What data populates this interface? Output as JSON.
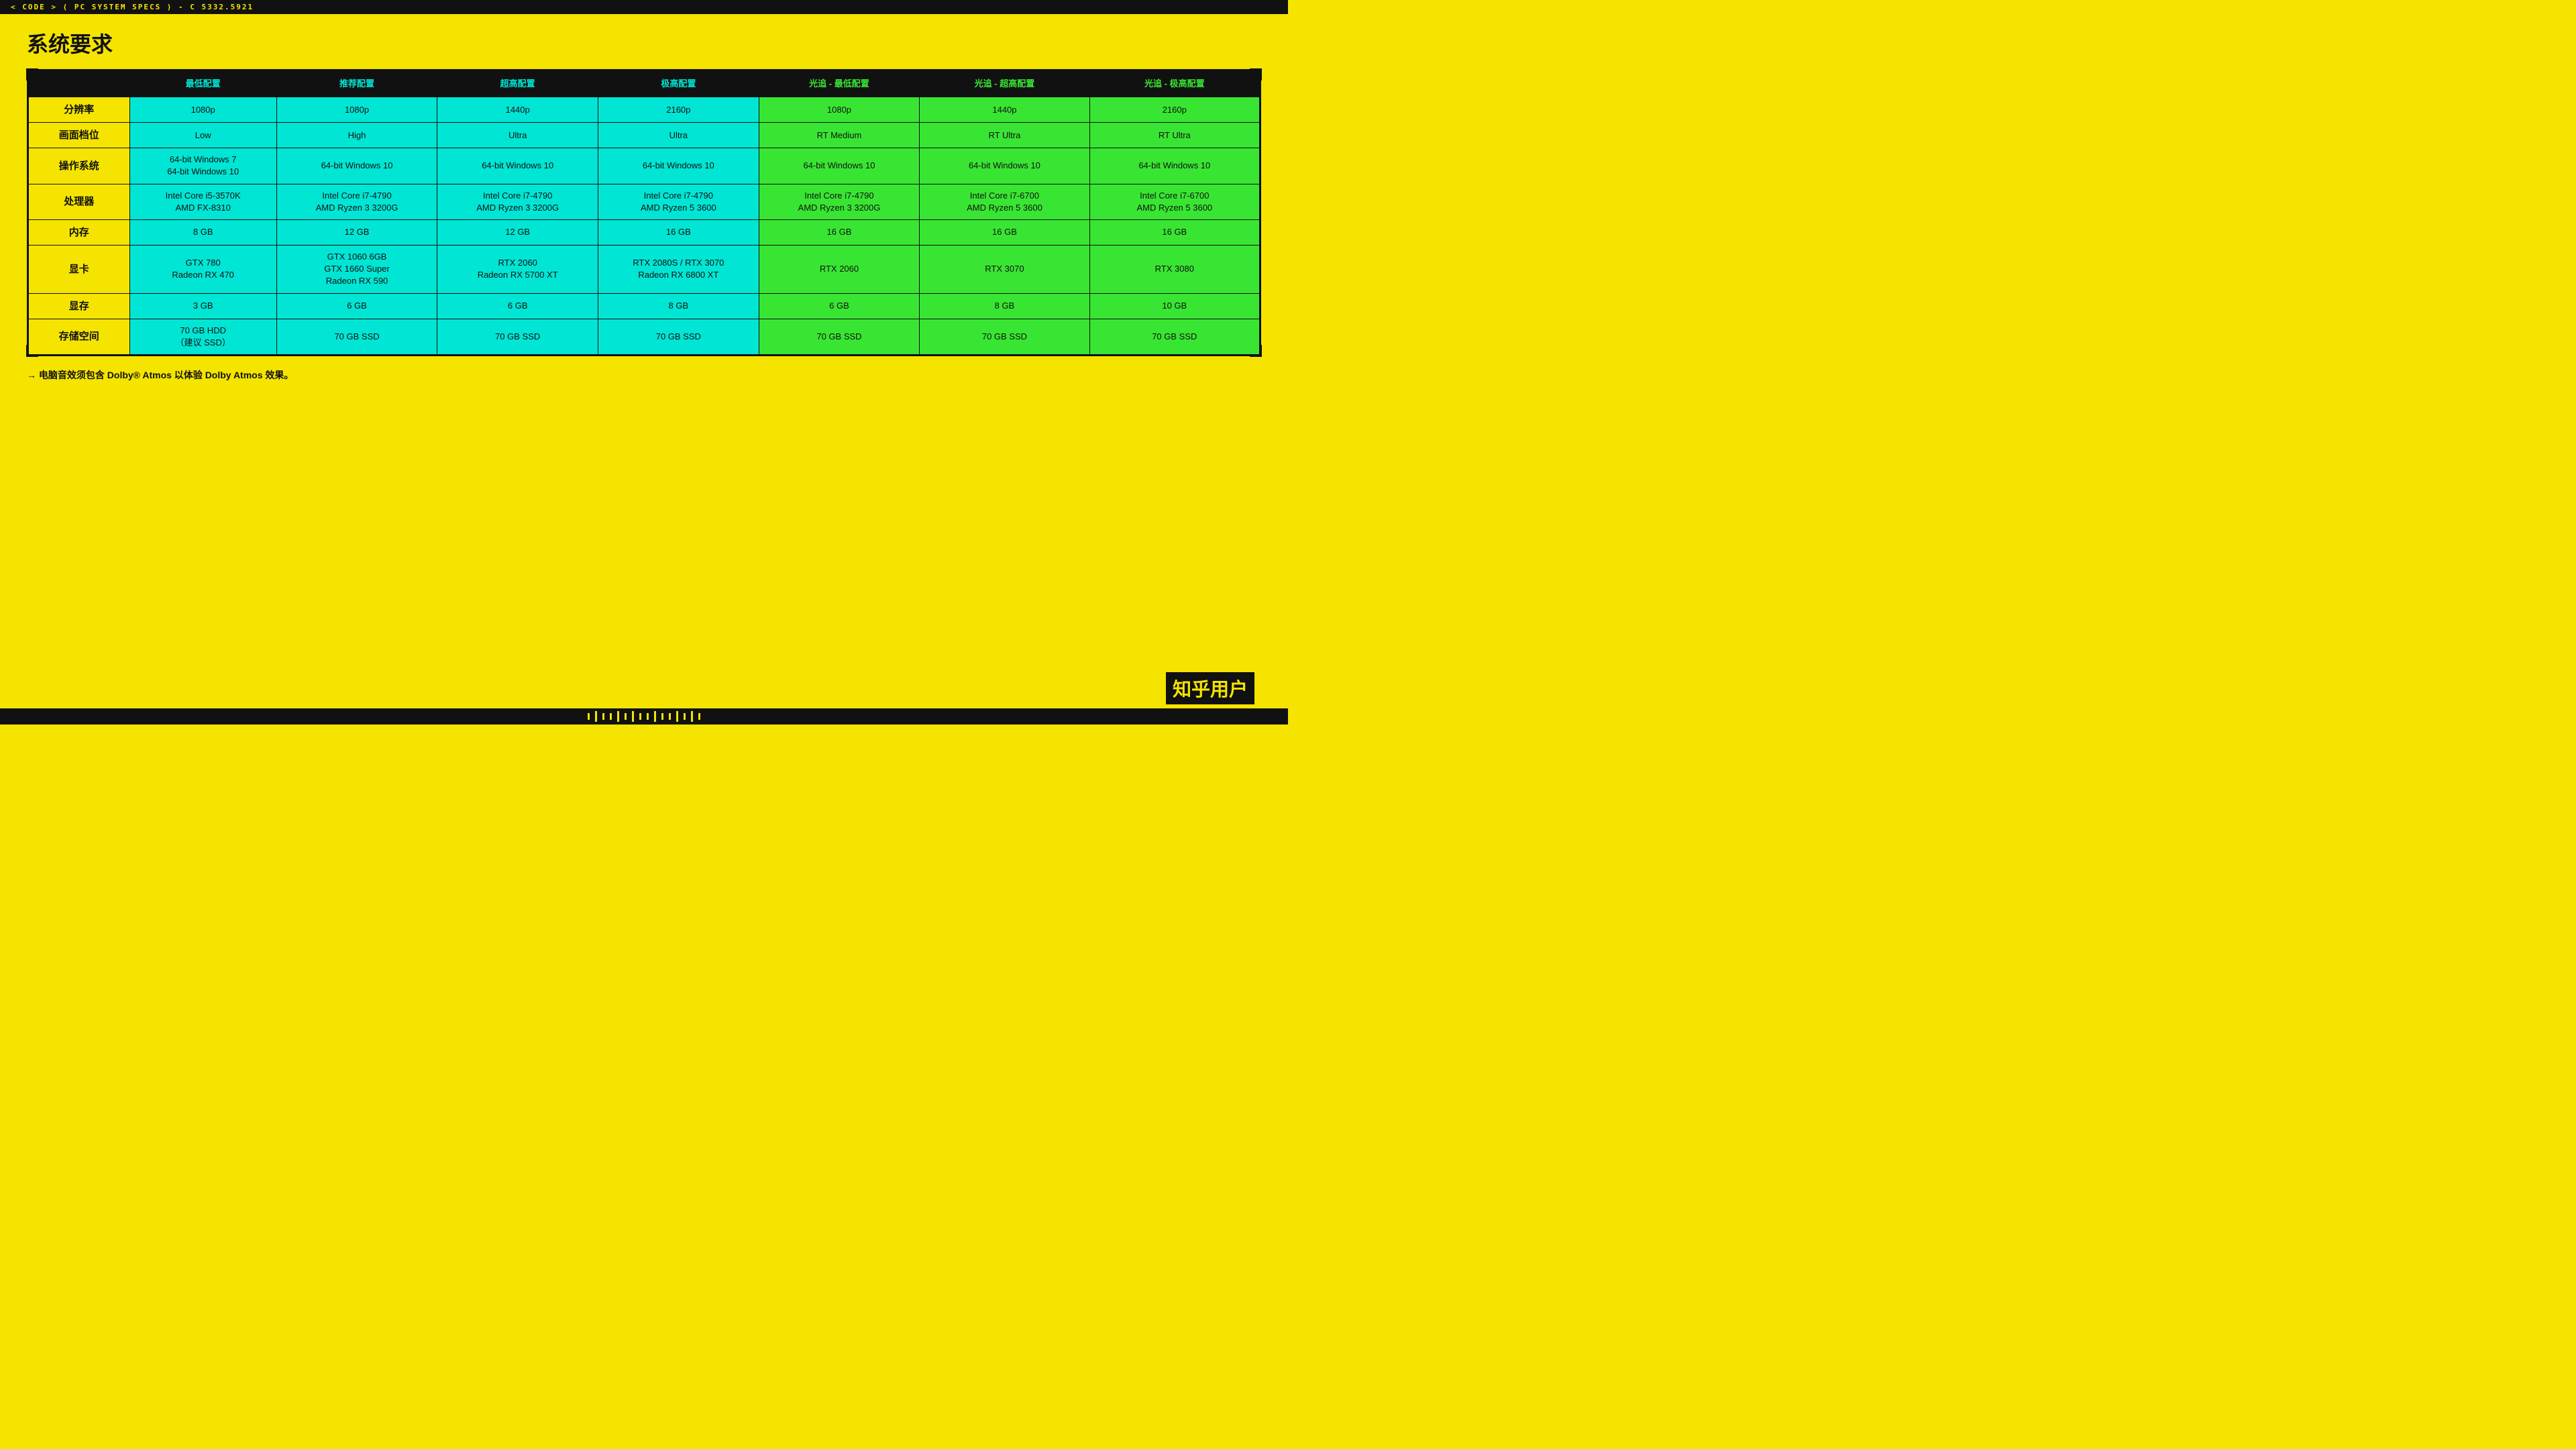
{
  "topbar": {
    "text": "< CODE > ( PC SYSTEM SPECS ) - C 5332.5921"
  },
  "page_title": "系统要求",
  "columns": {
    "row_header": "",
    "col1": {
      "label": "最低配置",
      "type": "cyan"
    },
    "col2": {
      "label": "推荐配置",
      "type": "cyan"
    },
    "col3": {
      "label": "超高配置",
      "type": "cyan"
    },
    "col4": {
      "label": "极高配置",
      "type": "cyan"
    },
    "col5": {
      "label": "光追 - 最低配置",
      "type": "green"
    },
    "col6": {
      "label": "光追 - 超高配置",
      "type": "green"
    },
    "col7": {
      "label": "光追 - 极高配置",
      "type": "green"
    }
  },
  "rows": [
    {
      "label": "分辨率",
      "values": [
        "1080p",
        "1080p",
        "1440p",
        "2160p",
        "1080p",
        "1440p",
        "2160p"
      ]
    },
    {
      "label": "画面档位",
      "values": [
        "Low",
        "High",
        "Ultra",
        "Ultra",
        "RT Medium",
        "RT Ultra",
        "RT Ultra"
      ]
    },
    {
      "label": "操作系统",
      "values": [
        "64-bit Windows 7\n64-bit Windows 10",
        "64-bit Windows 10",
        "64-bit Windows 10",
        "64-bit Windows 10",
        "64-bit Windows 10",
        "64-bit Windows 10",
        "64-bit Windows 10"
      ]
    },
    {
      "label": "处理器",
      "values": [
        "Intel Core i5-3570K\nAMD FX-8310",
        "Intel Core i7-4790\nAMD Ryzen 3 3200G",
        "Intel Core i7-4790\nAMD Ryzen 3 3200G",
        "Intel Core i7-4790\nAMD Ryzen 5 3600",
        "Intel Core i7-4790\nAMD Ryzen 3 3200G",
        "Intel Core i7-6700\nAMD Ryzen 5 3600",
        "Intel Core i7-6700\nAMD Ryzen 5 3600"
      ]
    },
    {
      "label": "内存",
      "values": [
        "8 GB",
        "12 GB",
        "12 GB",
        "16 GB",
        "16 GB",
        "16 GB",
        "16 GB"
      ]
    },
    {
      "label": "显卡",
      "values": [
        "GTX 780\nRadeon RX 470",
        "GTX 1060 6GB\nGTX 1660 Super\nRadeon RX 590",
        "RTX 2060\nRadeon RX 5700 XT",
        "RTX 2080S / RTX 3070\nRadeon RX 6800 XT",
        "RTX 2060",
        "RTX 3070",
        "RTX 3080"
      ]
    },
    {
      "label": "显存",
      "values": [
        "3 GB",
        "6 GB",
        "6 GB",
        "8 GB",
        "6 GB",
        "8 GB",
        "10 GB"
      ]
    },
    {
      "label": "存储空间",
      "values": [
        "70 GB HDD\n（建议 SSD）",
        "70 GB SSD",
        "70 GB SSD",
        "70 GB SSD",
        "70 GB SSD",
        "70 GB SSD",
        "70 GB SSD"
      ]
    }
  ],
  "note": "→ 电脑音效须包含 Dolby® Atmos 以体验 Dolby Atmos 效果。",
  "watermark": "知乎用户"
}
